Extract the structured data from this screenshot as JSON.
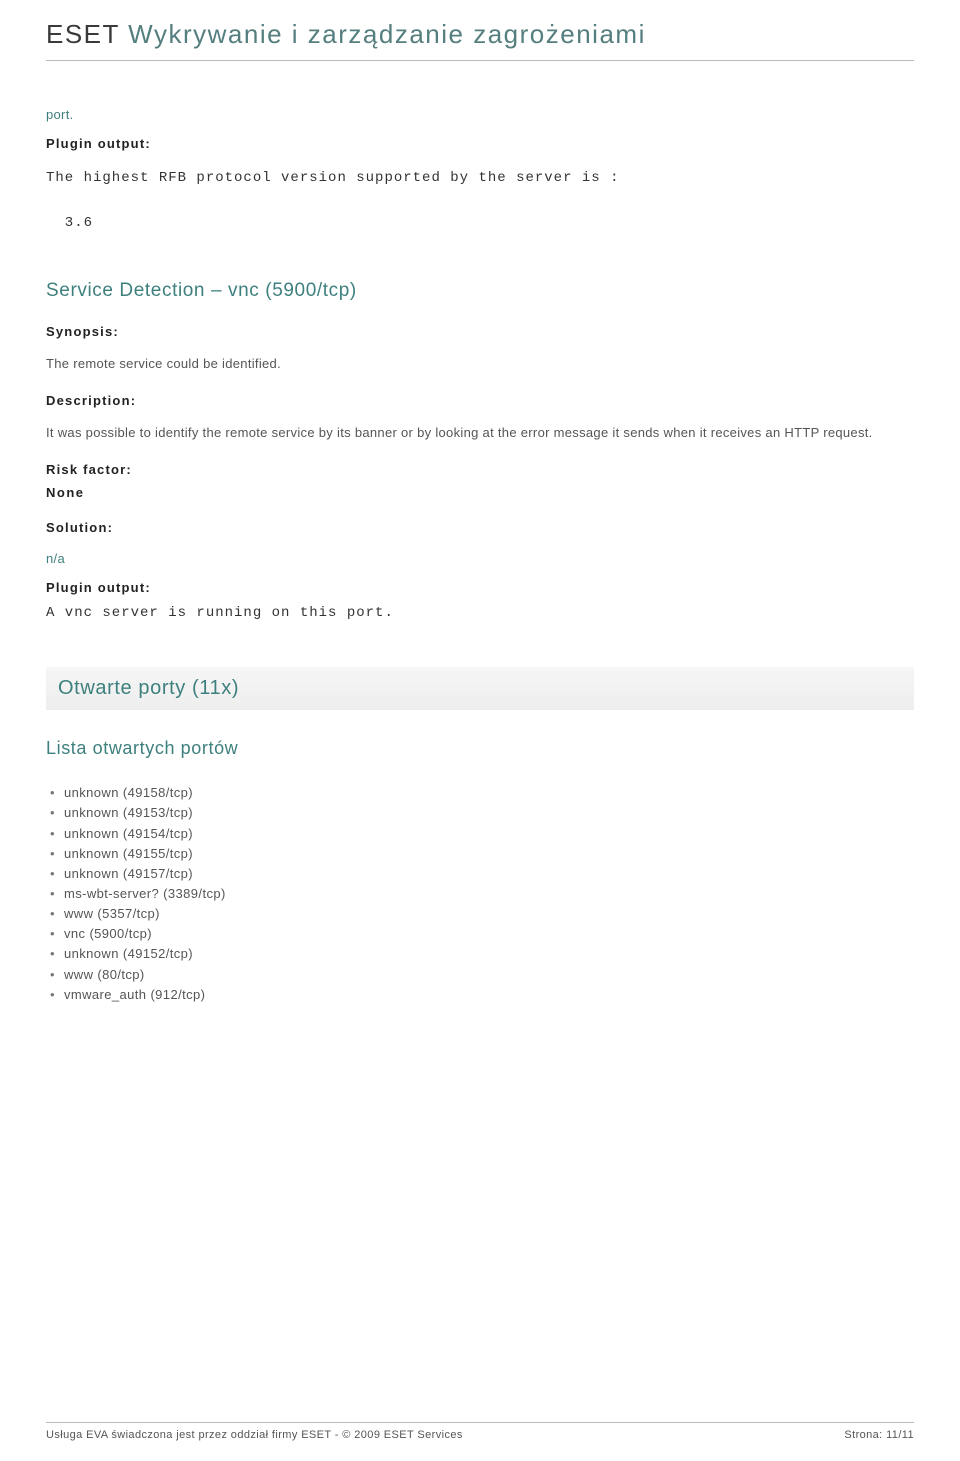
{
  "header": {
    "brand": "ESET",
    "subtitle": "Wykrywanie i zarządzanie zagrożeniami"
  },
  "section1": {
    "port_label": "port.",
    "plugin_output_label": "Plugin output:",
    "plugin_output_line1": "The highest RFB protocol version supported by the server is :",
    "plugin_output_line2": "  3.6"
  },
  "section2": {
    "title": "Service Detection – vnc (5900/tcp)",
    "synopsis_label": "Synopsis:",
    "synopsis_text": "The remote service could be identified.",
    "description_label": "Description:",
    "description_text": "It was possible to identify the remote service by its banner or by looking at the error message it sends when it receives an HTTP request.",
    "risk_label": "Risk factor:",
    "risk_value": "None",
    "solution_label": "Solution:",
    "solution_text": "n/a",
    "plugin_output_label": "Plugin output:",
    "plugin_output_text": "A vnc server is running on this port."
  },
  "open_ports": {
    "banner": "Otwarte porty (11x)",
    "list_heading": "Lista otwartych portów",
    "items": [
      "unknown (49158/tcp)",
      "unknown (49153/tcp)",
      "unknown (49154/tcp)",
      "unknown (49155/tcp)",
      "unknown (49157/tcp)",
      "ms-wbt-server? (3389/tcp)",
      "www (5357/tcp)",
      "vnc (5900/tcp)",
      "unknown (49152/tcp)",
      "www (80/tcp)",
      "vmware_auth (912/tcp)"
    ]
  },
  "footer": {
    "left": "Usługa EVA świadczona jest przez oddział firmy ESET - © 2009 ESET Services",
    "right": "Strona: 11/11"
  }
}
